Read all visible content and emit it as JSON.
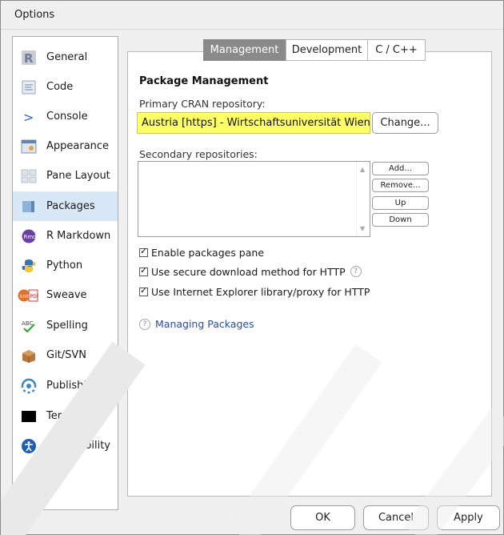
{
  "window": {
    "title": "Options"
  },
  "sidebar": {
    "items": [
      {
        "label": "General",
        "icon": "r-logo-icon"
      },
      {
        "label": "Code",
        "icon": "code-icon"
      },
      {
        "label": "Console",
        "icon": "console-icon"
      },
      {
        "label": "Appearance",
        "icon": "appearance-icon"
      },
      {
        "label": "Pane Layout",
        "icon": "pane-layout-icon"
      },
      {
        "label": "Packages",
        "icon": "packages-icon",
        "active": true
      },
      {
        "label": "R Markdown",
        "icon": "rmarkdown-icon"
      },
      {
        "label": "Python",
        "icon": "python-icon"
      },
      {
        "label": "Sweave",
        "icon": "sweave-icon"
      },
      {
        "label": "Spelling",
        "icon": "spelling-icon"
      },
      {
        "label": "Git/SVN",
        "icon": "git-icon"
      },
      {
        "label": "Publishing",
        "icon": "publishing-icon"
      },
      {
        "label": "Terminal",
        "icon": "terminal-icon"
      },
      {
        "label": "Accessibility",
        "icon": "accessibility-icon"
      }
    ]
  },
  "tabs": [
    {
      "label": "Management",
      "active": true
    },
    {
      "label": "Development",
      "active": false
    },
    {
      "label": "C / C++",
      "active": false
    }
  ],
  "management": {
    "section_title": "Package Management",
    "cran_label": "Primary CRAN repository:",
    "cran_value": "Austria [https] - Wirtschaftsuniversität Wien",
    "change_button": "Change...",
    "secondary_label": "Secondary repositories:",
    "secondary_buttons": {
      "add": "Add...",
      "remove": "Remove...",
      "up": "Up",
      "down": "Down"
    },
    "checkboxes": [
      {
        "label": "Enable packages pane",
        "checked": true
      },
      {
        "label": "Use secure download method for HTTP",
        "checked": true,
        "help": true
      },
      {
        "label": "Use Internet Explorer library/proxy for HTTP",
        "checked": true
      }
    ],
    "help_link": "Managing Packages"
  },
  "footer": {
    "ok": "OK",
    "cancel": "Cancel",
    "apply": "Apply"
  },
  "colors": {
    "highlight": "#ffff66",
    "active_tab": "#8a8a8a",
    "sidebar_active": "#d9e8f6",
    "link": "#2a4b9b"
  }
}
